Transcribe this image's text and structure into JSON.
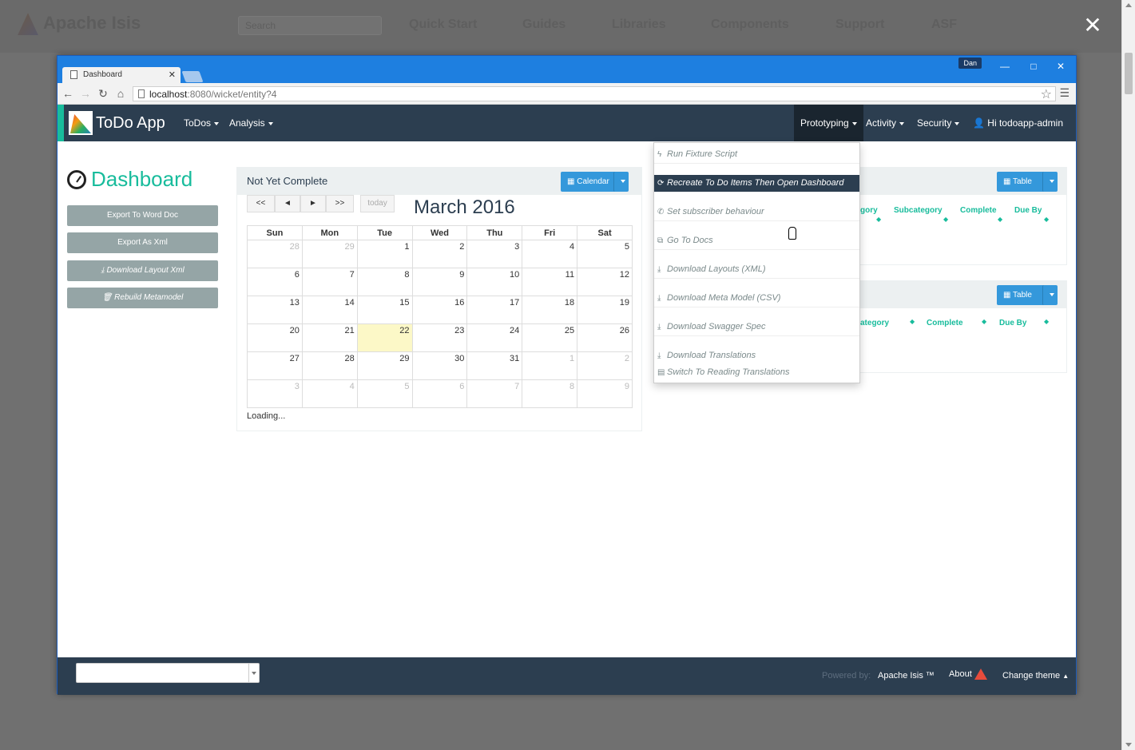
{
  "background": {
    "logo": "Apache Isis",
    "search_placeholder": "Search",
    "nav": [
      "Quick Start",
      "Guides",
      "Libraries",
      "Components",
      "Support",
      "ASF"
    ]
  },
  "browser": {
    "tab_title": "Dashboard",
    "user": "Dan",
    "url_host": "localhost",
    "url_path": ":8080/wicket/entity?4"
  },
  "app": {
    "brand": "ToDo App",
    "nav_left": [
      "ToDos",
      "Analysis"
    ],
    "nav_right": [
      "Prototyping",
      "Activity",
      "Security",
      "Hi todoapp-admin"
    ],
    "page_title": "Dashboard",
    "actions": [
      "Export To Word Doc",
      "Export As Xml",
      "Download Layout Xml",
      "Rebuild Metamodel"
    ]
  },
  "calendar_panel": {
    "title": "Not Yet Complete",
    "view_button": "Calendar",
    "nav_buttons": [
      "<<",
      "◄",
      "►",
      ">>"
    ],
    "today_button": "today",
    "month_title": "March 2016",
    "weekdays": [
      "Sun",
      "Mon",
      "Tue",
      "Wed",
      "Thu",
      "Fri",
      "Sat"
    ],
    "weeks": [
      [
        [
          "28",
          1
        ],
        [
          "29",
          1
        ],
        [
          "1",
          0
        ],
        [
          "2",
          0
        ],
        [
          "3",
          0
        ],
        [
          "4",
          0
        ],
        [
          "5",
          0
        ]
      ],
      [
        [
          "6",
          0
        ],
        [
          "7",
          0
        ],
        [
          "8",
          0
        ],
        [
          "9",
          0
        ],
        [
          "10",
          0
        ],
        [
          "11",
          0
        ],
        [
          "12",
          0
        ]
      ],
      [
        [
          "13",
          0
        ],
        [
          "14",
          0
        ],
        [
          "15",
          0
        ],
        [
          "16",
          0
        ],
        [
          "17",
          0
        ],
        [
          "18",
          0
        ],
        [
          "19",
          0
        ]
      ],
      [
        [
          "20",
          0
        ],
        [
          "21",
          0
        ],
        [
          "22",
          2
        ],
        [
          "23",
          0
        ],
        [
          "24",
          0
        ],
        [
          "25",
          0
        ],
        [
          "26",
          0
        ]
      ],
      [
        [
          "27",
          0
        ],
        [
          "28",
          0
        ],
        [
          "29",
          0
        ],
        [
          "30",
          0
        ],
        [
          "31",
          0
        ],
        [
          "1",
          1
        ],
        [
          "2",
          1
        ]
      ],
      [
        [
          "3",
          1
        ],
        [
          "4",
          1
        ],
        [
          "5",
          1
        ],
        [
          "6",
          1
        ],
        [
          "7",
          1
        ],
        [
          "8",
          1
        ],
        [
          "9",
          1
        ]
      ]
    ],
    "status": "Loading..."
  },
  "right_panels": [
    {
      "button": "Table",
      "columns": [
        "gory",
        "Subcategory",
        "Complete",
        "Due By"
      ]
    },
    {
      "button": "Table",
      "columns": [
        "ategory",
        "Complete",
        "Due By"
      ]
    }
  ],
  "dropdown": {
    "items": [
      {
        "icon": "bolt-icon",
        "glyph": "ϟ",
        "label": "Run Fixture Script"
      },
      {
        "icon": "refresh-icon",
        "glyph": "⟳",
        "label": "Recreate To Do Items Then Open Dashboard"
      },
      {
        "icon": "phone-icon",
        "glyph": "✆",
        "label": "Set subscriber behaviour"
      },
      {
        "icon": "external-link-icon",
        "glyph": "⧉",
        "label": "Go To Docs"
      },
      {
        "icon": "download-icon",
        "glyph": "⤓",
        "label": "Download Layouts (XML)"
      },
      {
        "icon": "download-icon",
        "glyph": "⤓",
        "label": "Download Meta Model (CSV)"
      },
      {
        "icon": "download-icon",
        "glyph": "⤓",
        "label": "Download Swagger Spec"
      },
      {
        "icon": "download-icon",
        "glyph": "⤓",
        "label": "Download Translations"
      },
      {
        "icon": "book-icon",
        "glyph": "▤",
        "label": "Switch To Reading Translations"
      }
    ]
  },
  "footer": {
    "powered_by": "Powered by:",
    "framework": "Apache Isis ™",
    "about": "About",
    "change_theme": "Change theme"
  },
  "colors": {
    "accent": "#18bc9c",
    "navbar": "#2c3e50",
    "primary": "#3498db",
    "today": "#fcf8c7"
  }
}
